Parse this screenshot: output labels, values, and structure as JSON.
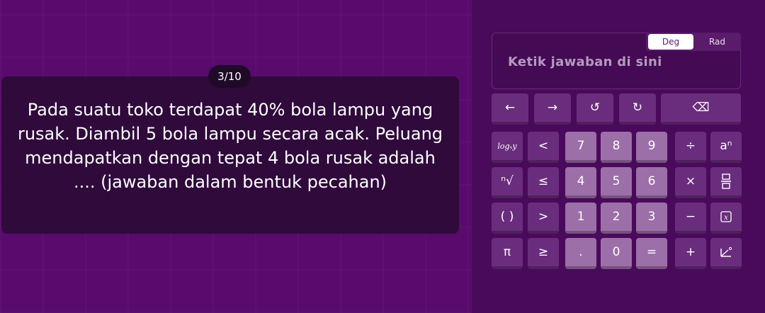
{
  "question": {
    "counter": "3/10",
    "text": "Pada suatu toko terdapat 40% bola lampu yang rusak. Diambil 5 bola lampu secara acak. Peluang mendapatkan dengan tepat 4 bola rusak adalah .... (jawaban dalam bentuk pecahan)"
  },
  "answer": {
    "placeholder": "Ketik jawaban di sini",
    "mode_deg": "Deg",
    "mode_rad": "Rad"
  },
  "keypad": {
    "row1": [
      "←",
      "→",
      "↺",
      "↻",
      "⌫"
    ],
    "row2": [
      "logₓy",
      "<",
      "7",
      "8",
      "9",
      "÷",
      "aⁿ"
    ],
    "row3": [
      "ⁿ√",
      "≤",
      "4",
      "5",
      "6",
      "×",
      "fraction"
    ],
    "row4": [
      "( )",
      ">",
      "1",
      "2",
      "3",
      "−",
      "x-box"
    ],
    "row5": [
      "π",
      "≥",
      ".",
      "0",
      "=",
      "+",
      "angle"
    ]
  },
  "colors": {
    "background": "#580b6c",
    "panel": "#4a0a5b",
    "card": "#2f0a3b",
    "key_dark": "#6a2d7d",
    "key_light": "#9c6fa8"
  }
}
